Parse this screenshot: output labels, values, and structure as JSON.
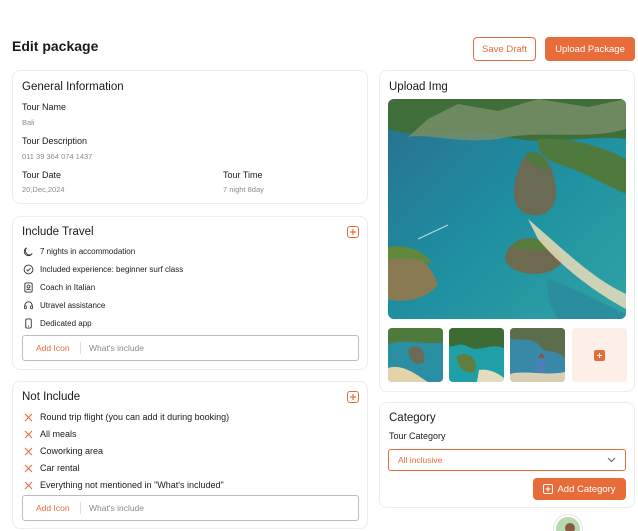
{
  "page": {
    "title": "Edit package"
  },
  "header": {
    "save_draft": "Save Draft",
    "upload_package": "Upload Package"
  },
  "general": {
    "title": "General Information",
    "tour_name_label": "Tour Name",
    "tour_name_value": "Bali",
    "tour_desc_label": "Tour Description",
    "tour_desc_value": "011 39 364 074 1437",
    "tour_date_label": "Tour Date",
    "tour_date_value": "20,Dec,2024",
    "tour_time_label": "Tour Time",
    "tour_time_value": "7 night 8day"
  },
  "include": {
    "title": "Include Travel",
    "items": [
      {
        "label": "7 nights in accommodation",
        "icon": "moon-icon"
      },
      {
        "label": "Included experience: beginner surf class",
        "icon": "badge-check-icon"
      },
      {
        "label": "Coach in Italian",
        "icon": "id-badge-icon"
      },
      {
        "label": "Utravel assistance",
        "icon": "headset-icon"
      },
      {
        "label": "Dedicated app",
        "icon": "phone-icon"
      }
    ],
    "add_icon": "Add Icon",
    "placeholder": "What's include"
  },
  "not_include": {
    "title": "Not Include",
    "items": [
      "Round trip flight (you can add it during booking)",
      "All meals",
      "Coworking area",
      "Car rental",
      "Everything not mentioned in \"What's included\""
    ],
    "add_icon": "Add Icon",
    "placeholder": "What's include"
  },
  "upload": {
    "title": "Upload Img"
  },
  "category": {
    "title": "Category",
    "label": "Tour Category",
    "selected": "All inclusive",
    "add_button": "Add Category"
  },
  "colors": {
    "accent": "#e86c3a",
    "border": "#ececec"
  }
}
